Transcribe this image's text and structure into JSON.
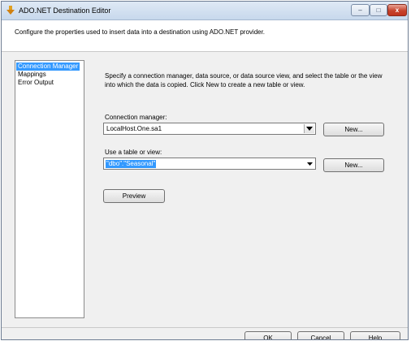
{
  "window": {
    "title": "ADO.NET Destination Editor",
    "controls": {
      "minimize": "–",
      "maximize": "□",
      "close": "x"
    }
  },
  "header": {
    "description": "Configure the properties used to insert data into a destination using ADO.NET provider."
  },
  "nav": {
    "items": [
      {
        "label": "Connection Manager",
        "selected": true
      },
      {
        "label": "Mappings",
        "selected": false
      },
      {
        "label": "Error Output",
        "selected": false
      }
    ]
  },
  "main": {
    "description": "Specify a connection manager, data source, or data source view, and select the table or the view into which the data is copied. Click New to create a new table or view.",
    "connection_manager": {
      "label": "Connection manager:",
      "value": "LocalHost.One.sa1",
      "new_button": "New..."
    },
    "table_or_view": {
      "label": "Use a table or view:",
      "value": "\"dbo\".\"Seasonal\"",
      "new_button": "New..."
    },
    "preview_button": "Preview"
  },
  "footer": {
    "ok": "OK",
    "cancel": "Cancel",
    "help": "Help"
  }
}
